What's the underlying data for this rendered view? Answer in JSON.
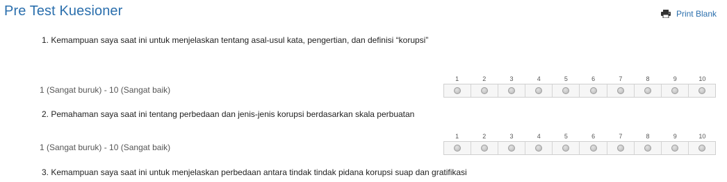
{
  "header": {
    "title": "Pre Test Kuesioner",
    "print_label": "Print Blank"
  },
  "questions": [
    {
      "text": "1. Kemampuan saya saat ini untuk menjelaskan tentang asal-usul kata, pengertian, dan definisi “korupsi”",
      "scale_label": "1 (Sangat buruk) - 10 (Sangat baik)",
      "options": [
        "1",
        "2",
        "3",
        "4",
        "5",
        "6",
        "7",
        "8",
        "9",
        "10"
      ],
      "selected": null
    },
    {
      "text": "2. Pemahaman saya saat ini tentang perbedaan dan jenis-jenis korupsi berdasarkan skala perbuatan",
      "scale_label": "1 (Sangat buruk) - 10 (Sangat baik)",
      "options": [
        "1",
        "2",
        "3",
        "4",
        "5",
        "6",
        "7",
        "8",
        "9",
        "10"
      ],
      "selected": null
    },
    {
      "text": "3. Kemampuan saya saat ini untuk menjelaskan perbedaan antara tindak tindak pidana korupsi suap dan gratifikasi"
    }
  ],
  "icons": {
    "print": "printer-icon"
  },
  "colors": {
    "accent": "#2b6fad",
    "text": "#222222",
    "cell_bg": "#f6f6f6",
    "cell_border": "#cfcfcf"
  }
}
